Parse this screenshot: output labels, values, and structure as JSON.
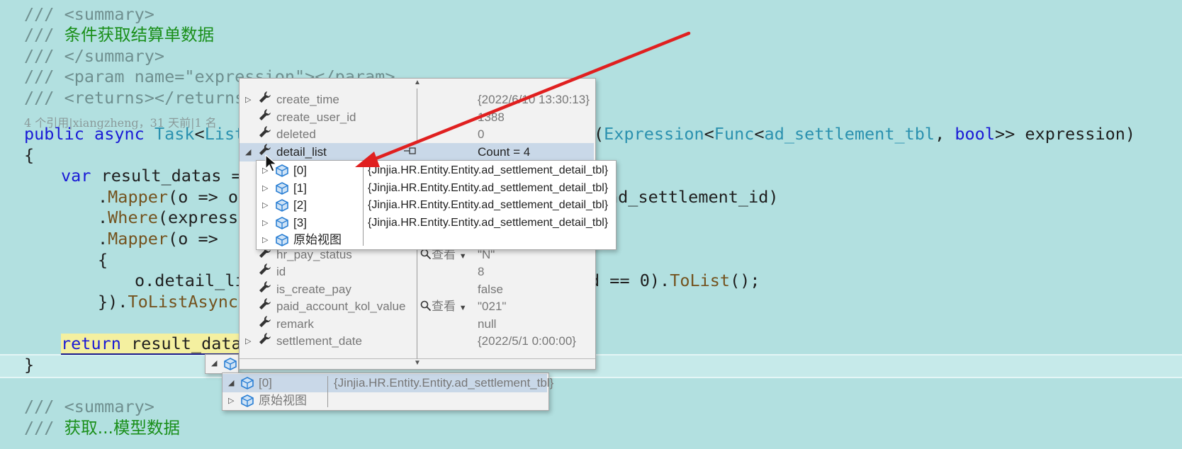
{
  "code": {
    "line1": "/// <summary>",
    "line2_prefix": "/// ",
    "line2_zh": "条件获取结算单数据",
    "line3": "/// </summary>",
    "line4": "/// <param name=\"expression\"></param>",
    "line5": "/// <returns></returns>",
    "codelens": "4 个引用|xiangzheng，31 天前|1 名",
    "sig_public": "public",
    "sig_async": "async",
    "sig_task": "Task",
    "sig_lt": "<",
    "sig_list": "List",
    "sig_lt2": "<",
    "sig_tail_open": "(",
    "sig_expression": "Expression",
    "sig_lt3": "<",
    "sig_func": "Func",
    "sig_lt4": "<",
    "sig_tbl": "ad_settlement_tbl",
    "sig_comma": ", ",
    "sig_bool": "bool",
    "sig_end": ">> expression)",
    "brace_open": "{",
    "var_kw": "var",
    "var_rest": " result_datas = ",
    "mapper1_dot": ".",
    "mapper1": "Mapper",
    "mapper1_rest": "(o => o.",
    "mapper1_tail": "ad_settlement_id)",
    "where_dot": ".",
    "where": "Where",
    "where_rest": "(expressio",
    "mapper2_dot": ".",
    "mapper2": "Mapper",
    "mapper2_rest": "(o =>",
    "inner_brace": "{",
    "detail_start": "o.detail_li",
    "detail_tail": "d == 0).",
    "tolist": "ToList",
    "tolist_end": "();",
    "close_start": "}).",
    "tolistasync": "ToListAsync",
    "close_paren": "(",
    "return_kw": "return",
    "return_rest": " result_datas",
    "brace_close": "}",
    "line_sum2": "/// <summary>",
    "line_sum3_prefix": "/// ",
    "line_sum3_zh": "获取...模型数据"
  },
  "popup_main": {
    "rows": [
      {
        "name": "create_time",
        "value": "{2022/6/10 13:30:13}",
        "expand": true,
        "grey": true
      },
      {
        "name": "create_user_id",
        "value": "1388",
        "expand": false,
        "grey": true
      },
      {
        "name": "deleted",
        "value": "0",
        "expand": false,
        "grey": true
      },
      {
        "name": "detail_list",
        "value": "Count = 4",
        "expand": true,
        "grey": false
      },
      {
        "name": "hr_pay_status",
        "value": "\"N\"",
        "expand": false,
        "grey": true,
        "viewer": "查看"
      },
      {
        "name": "id",
        "value": "8",
        "expand": false,
        "grey": true
      },
      {
        "name": "is_create_pay",
        "value": "false",
        "expand": false,
        "grey": true
      },
      {
        "name": "paid_account_kol_value",
        "value": "\"021\"",
        "expand": false,
        "grey": true,
        "viewer": "查看"
      },
      {
        "name": "remark",
        "value": "null",
        "expand": false,
        "grey": true
      },
      {
        "name": "settlement_date",
        "value": "{2022/5/1 0:00:00}",
        "expand": true,
        "grey": true
      }
    ]
  },
  "popup_detail": {
    "rows": [
      {
        "name": "[0]",
        "value": "{Jinjia.HR.Entity.Entity.ad_settlement_detail_tbl}"
      },
      {
        "name": "[1]",
        "value": "{Jinjia.HR.Entity.Entity.ad_settlement_detail_tbl}"
      },
      {
        "name": "[2]",
        "value": "{Jinjia.HR.Entity.Entity.ad_settlement_detail_tbl}"
      },
      {
        "name": "[3]",
        "value": "{Jinjia.HR.Entity.Entity.ad_settlement_detail_tbl}"
      },
      {
        "name": "原始视图",
        "value": ""
      }
    ]
  },
  "popup_outer": {
    "rows": [
      {
        "name": "[0]",
        "value": "{Jinjia.HR.Entity.Entity.ad_settlement_tbl}"
      },
      {
        "name": "原始视图",
        "value": ""
      }
    ]
  },
  "colors": {
    "background": "#b2e0e0",
    "arrow": "#e02020",
    "cube": "#2a7fd4"
  }
}
